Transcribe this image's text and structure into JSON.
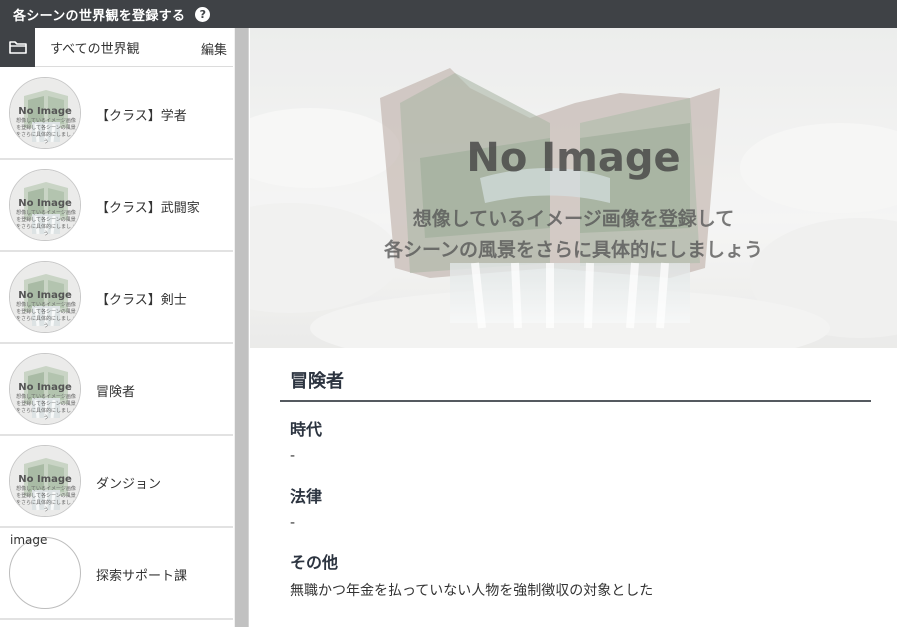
{
  "titlebar": {
    "title": "各シーンの世界観を登録する",
    "help_icon": "?"
  },
  "left": {
    "all_label": "すべての世界観",
    "edit_label": "編集",
    "items": [
      {
        "label": "【クラス】学者",
        "has_image": true
      },
      {
        "label": "【クラス】武闘家",
        "has_image": true
      },
      {
        "label": "【クラス】剣士",
        "has_image": true
      },
      {
        "label": "冒険者",
        "has_image": true
      },
      {
        "label": "ダンジョン",
        "has_image": true
      },
      {
        "label": "探索サポート課",
        "has_image": false,
        "image_alt": "image"
      }
    ],
    "thumb_title": "No Image",
    "thumb_sub": "想像しているイメージ画像を登録して各シーンの風景をさらに具体的にしましょう"
  },
  "hero": {
    "title": "No Image",
    "line1": "想像しているイメージ画像を登録して",
    "line2": "各シーンの風景をさらに具体的にしましょう"
  },
  "detail": {
    "name": "冒険者",
    "sections": [
      {
        "heading": "時代",
        "value": "-"
      },
      {
        "heading": "法律",
        "value": "-"
      },
      {
        "heading": "その他",
        "value": "無職かつ年金を払っていない人物を強制徴収の対象とした"
      }
    ]
  },
  "colors": {
    "titlebar_bg": "#3f4246",
    "heading_text": "#2c3440"
  }
}
